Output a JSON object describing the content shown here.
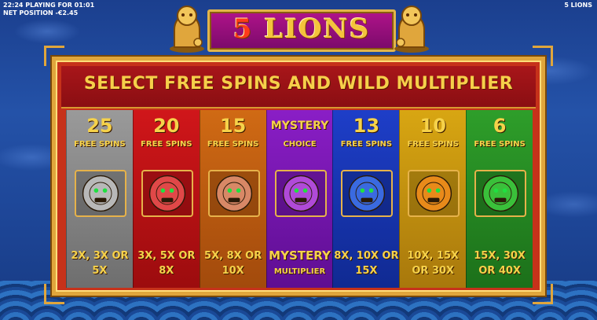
{
  "status": {
    "clock_line": "22:24  PLAYING FOR 01:01",
    "net_line": "NET POSITION -€2.45"
  },
  "game_name": "5 LIONS",
  "logo": {
    "five": "5",
    "word": "LIONS"
  },
  "header": {
    "title": "SELECT FREE SPINS AND WILD MULTIPLIER"
  },
  "panels": [
    {
      "count": "25",
      "label": "FREE SPINS",
      "mult": "2X, 3X OR 5X",
      "color": "#8a8a8a",
      "lion_color": "#b8b8b8"
    },
    {
      "count": "20",
      "label": "FREE SPINS",
      "mult": "3X, 5X OR 8X",
      "color": "#c01418",
      "lion_color": "#e04848"
    },
    {
      "count": "15",
      "label": "FREE SPINS",
      "mult": "5X, 8X OR 10X",
      "color": "#c05e12",
      "lion_color": "#d88866"
    },
    {
      "count": "MYSTERY",
      "label": "CHOICE",
      "mult": "MYSTERY",
      "mult2": "MULTIPLIER",
      "color": "#7a18b4",
      "lion_color": "#b04ad8"
    },
    {
      "count": "13",
      "label": "FREE SPINS",
      "mult": "8X, 10X OR 15X",
      "color": "#1a36b8",
      "lion_color": "#3a6ae0"
    },
    {
      "count": "10",
      "label": "FREE SPINS",
      "mult": "10X, 15X OR 30X",
      "color": "#c8960e",
      "lion_color": "#e88a1a"
    },
    {
      "count": "6",
      "label": "FREE SPINS",
      "mult": "15X, 30X OR 40X",
      "color": "#268a22",
      "lion_color": "#3ac03a"
    }
  ]
}
